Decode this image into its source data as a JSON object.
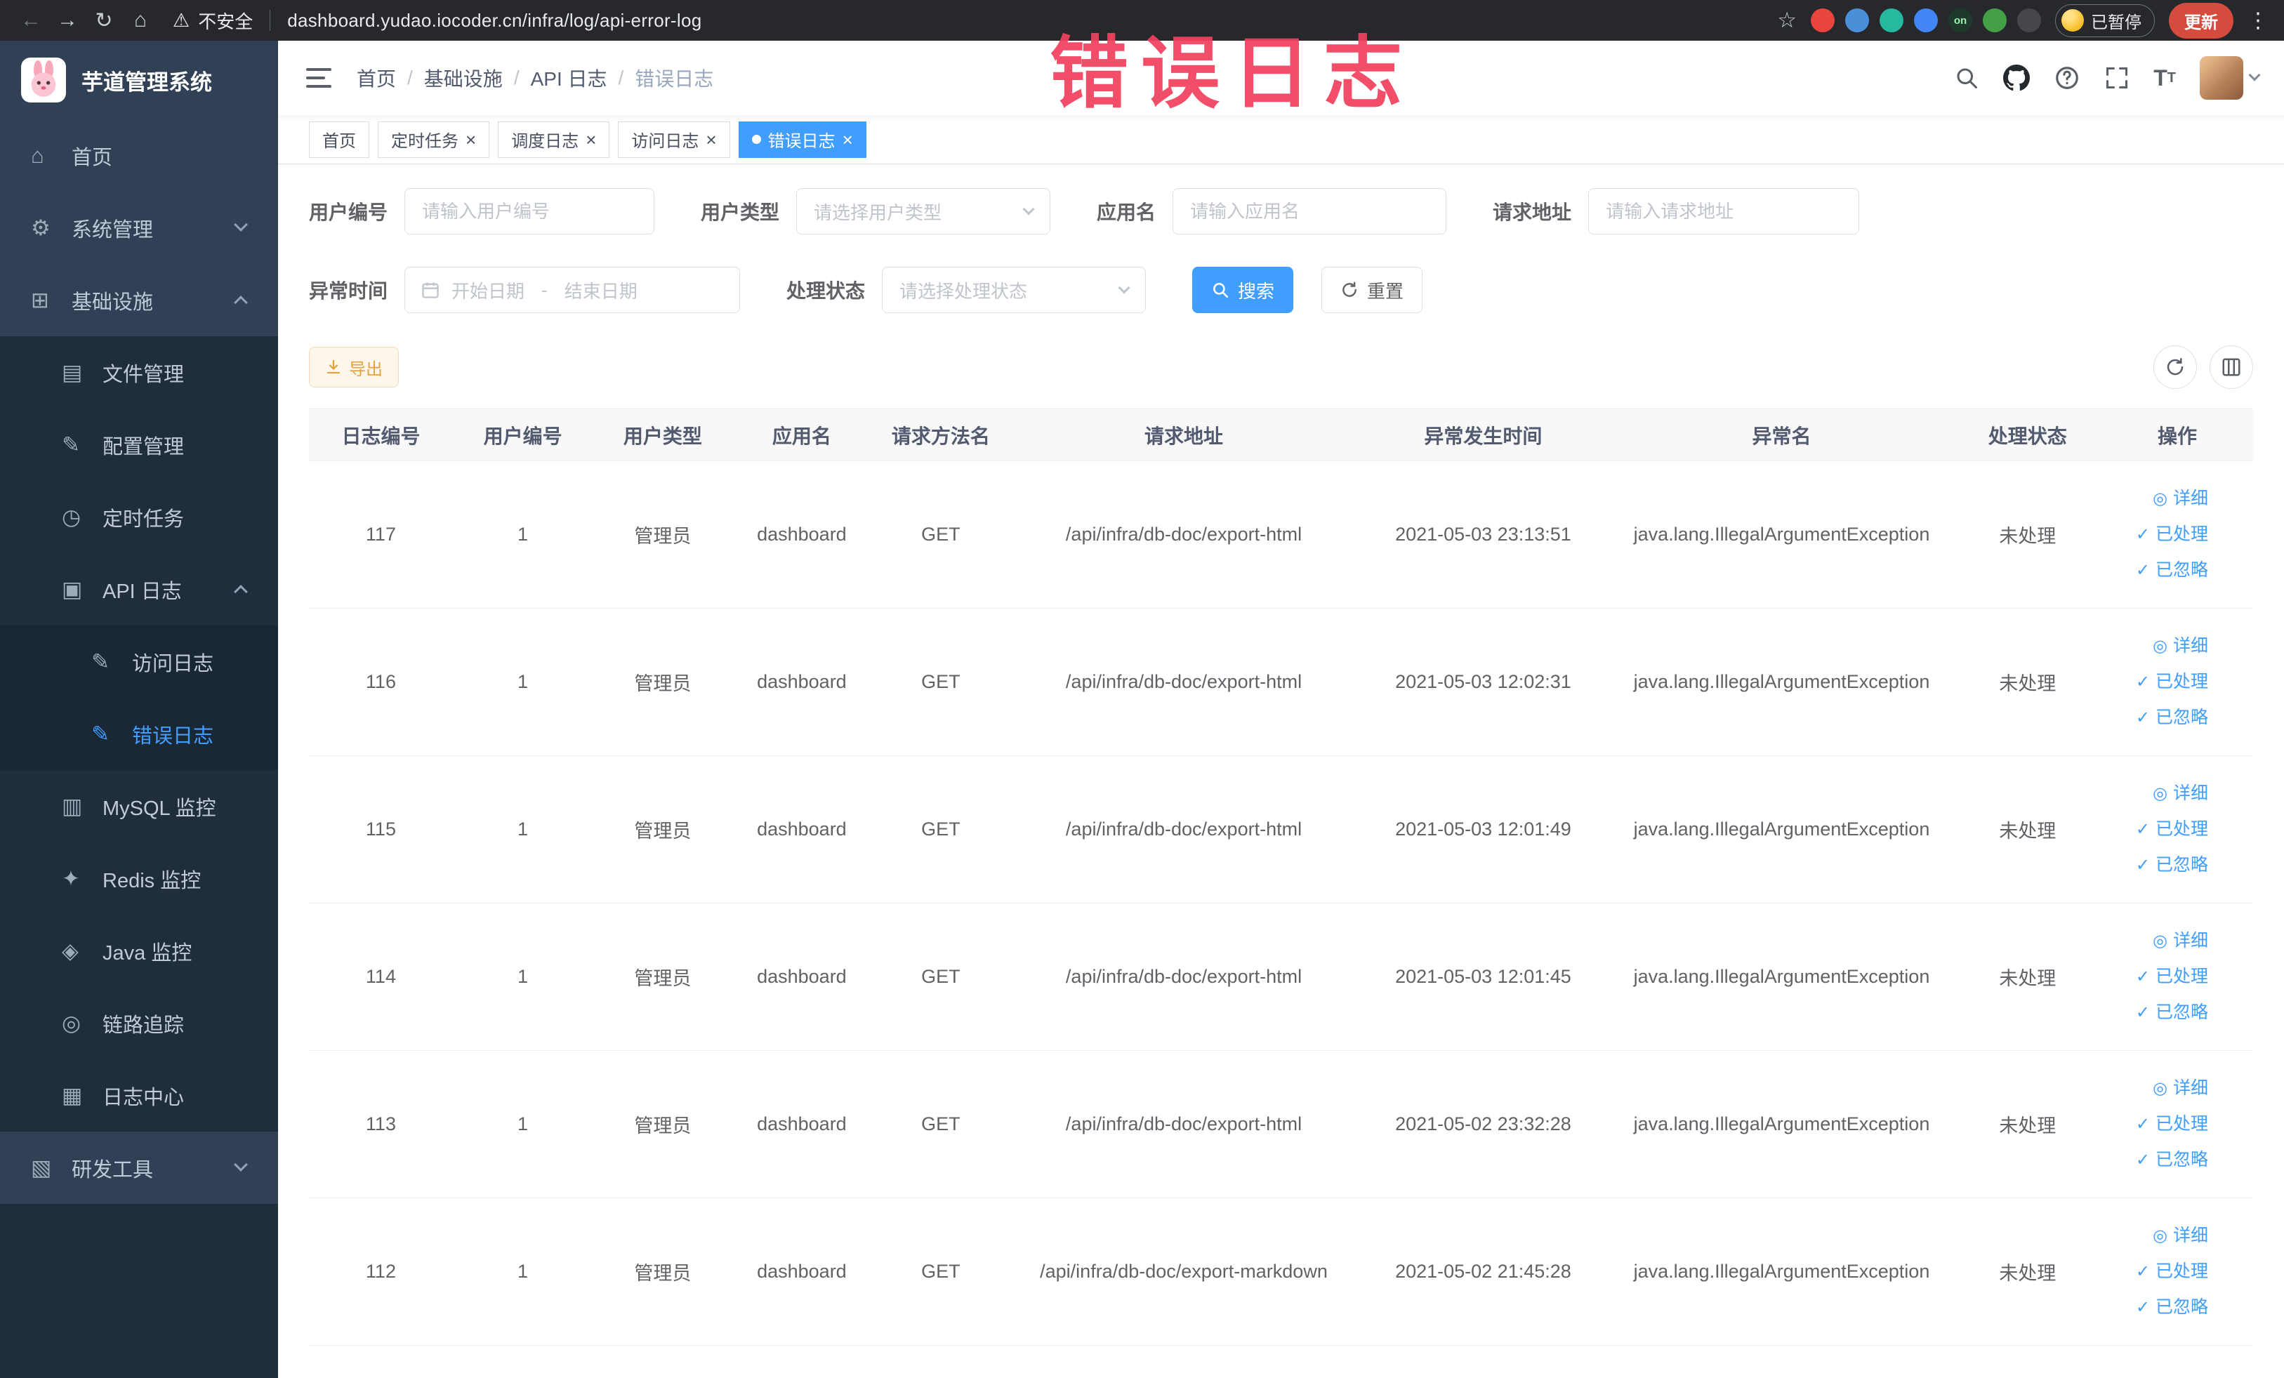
{
  "colors": {
    "accent": "#409eff",
    "sidebar_bg": "#304156",
    "sidebar_submenu_bg": "#1f2d3d",
    "active_menu_text": "#409eff",
    "warning_button_text": "#e6a23c",
    "update_button_bg": "#d54c3f",
    "watermark_color": "#f3415e"
  },
  "watermark": "错误日志",
  "browser": {
    "security_label": "不安全",
    "url": "dashboard.yudao.iocoder.cn/infra/log/api-error-log",
    "paused_label": "已暂停",
    "update_label": "更新",
    "extensions": [
      {
        "name": "extension-red-icon",
        "color": "#e8453c",
        "glyph": ""
      },
      {
        "name": "extension-blue-drop-icon",
        "color": "#4a90d9",
        "glyph": ""
      },
      {
        "name": "extension-teal-icon",
        "color": "#27b8a0",
        "glyph": ""
      },
      {
        "name": "extension-grid-icon",
        "color": "#4285f4",
        "glyph": ""
      },
      {
        "name": "extension-on-badge-icon",
        "color": "#1e3a2a",
        "glyph": "on"
      },
      {
        "name": "extension-leaf-icon",
        "color": "#43a047",
        "glyph": ""
      },
      {
        "name": "extension-paw-icon",
        "color": "#45474a",
        "glyph": ""
      }
    ]
  },
  "sidebar": {
    "logo_title": "芋道管理系统",
    "items": [
      {
        "name": "home",
        "label": "首页",
        "level": 1,
        "icon": "home-icon"
      },
      {
        "name": "system-management",
        "label": "系统管理",
        "level": 1,
        "icon": "gear-icon",
        "chevron": "down"
      },
      {
        "name": "infrastructure",
        "label": "基础设施",
        "level": 1,
        "icon": "infra-icon",
        "chevron": "up"
      },
      {
        "name": "file-management",
        "label": "文件管理",
        "level": 2,
        "icon": "file-icon"
      },
      {
        "name": "config-management",
        "label": "配置管理",
        "level": 2,
        "icon": "config-icon"
      },
      {
        "name": "scheduled-tasks",
        "label": "定时任务",
        "level": 2,
        "icon": "timer-icon"
      },
      {
        "name": "api-logs",
        "label": "API 日志",
        "level": 2,
        "icon": "api-log-icon",
        "chevron": "up"
      },
      {
        "name": "access-logs",
        "label": "访问日志",
        "level": 3,
        "icon": "edit-square-icon"
      },
      {
        "name": "error-logs",
        "label": "错误日志",
        "level": 3,
        "icon": "edit-square-icon",
        "active": true
      },
      {
        "name": "mysql-monitor",
        "label": "MySQL 监控",
        "level": 2,
        "icon": "mysql-icon"
      },
      {
        "name": "redis-monitor",
        "label": "Redis 监控",
        "level": 2,
        "icon": "redis-icon"
      },
      {
        "name": "java-monitor",
        "label": "Java 监控",
        "level": 2,
        "icon": "java-icon"
      },
      {
        "name": "trace",
        "label": "链路追踪",
        "level": 2,
        "icon": "trace-icon"
      },
      {
        "name": "log-center",
        "label": "日志中心",
        "level": 2,
        "icon": "log-center-icon"
      },
      {
        "name": "dev-tools",
        "label": "研发工具",
        "level": 1,
        "icon": "tools-icon",
        "chevron": "down"
      }
    ]
  },
  "header": {
    "breadcrumb": [
      "首页",
      "基础设施",
      "API 日志",
      "错误日志"
    ]
  },
  "tabs": [
    {
      "label": "首页",
      "closable": false,
      "active": false
    },
    {
      "label": "定时任务",
      "closable": true,
      "active": false
    },
    {
      "label": "调度日志",
      "closable": true,
      "active": false
    },
    {
      "label": "访问日志",
      "closable": true,
      "active": false
    },
    {
      "label": "错误日志",
      "closable": true,
      "active": true
    }
  ],
  "filters": {
    "user_id": {
      "label": "用户编号",
      "placeholder": "请输入用户编号"
    },
    "user_type": {
      "label": "用户类型",
      "placeholder": "请选择用户类型"
    },
    "app_name": {
      "label": "应用名",
      "placeholder": "请输入应用名"
    },
    "request_url": {
      "label": "请求地址",
      "placeholder": "请输入请求地址"
    },
    "exception_time": {
      "label": "异常时间",
      "start_placeholder": "开始日期",
      "separator": "-",
      "end_placeholder": "结束日期"
    },
    "process_status": {
      "label": "处理状态",
      "placeholder": "请选择处理状态"
    },
    "search_label": "搜索",
    "reset_label": "重置"
  },
  "toolbar": {
    "export_label": "导出"
  },
  "table": {
    "columns": [
      "日志编号",
      "用户编号",
      "用户类型",
      "应用名",
      "请求方法名",
      "请求地址",
      "异常发生时间",
      "异常名",
      "处理状态",
      "操作"
    ],
    "rows": [
      [
        "117",
        "1",
        "管理员",
        "dashboard",
        "GET",
        "/api/infra/db-doc/export-html",
        "2021-05-03 23:13:51",
        "java.lang.IllegalArgumentException",
        "未处理"
      ],
      [
        "116",
        "1",
        "管理员",
        "dashboard",
        "GET",
        "/api/infra/db-doc/export-html",
        "2021-05-03 12:02:31",
        "java.lang.IllegalArgumentException",
        "未处理"
      ],
      [
        "115",
        "1",
        "管理员",
        "dashboard",
        "GET",
        "/api/infra/db-doc/export-html",
        "2021-05-03 12:01:49",
        "java.lang.IllegalArgumentException",
        "未处理"
      ],
      [
        "114",
        "1",
        "管理员",
        "dashboard",
        "GET",
        "/api/infra/db-doc/export-html",
        "2021-05-03 12:01:45",
        "java.lang.IllegalArgumentException",
        "未处理"
      ],
      [
        "113",
        "1",
        "管理员",
        "dashboard",
        "GET",
        "/api/infra/db-doc/export-html",
        "2021-05-02 23:32:28",
        "java.lang.IllegalArgumentException",
        "未处理"
      ],
      [
        "112",
        "1",
        "管理员",
        "dashboard",
        "GET",
        "/api/infra/db-doc/export-markdown",
        "2021-05-02 21:45:28",
        "java.lang.IllegalArgumentException",
        "未处理"
      ]
    ],
    "row_actions": [
      {
        "name": "detail",
        "icon": "eye-icon",
        "label": "详细"
      },
      {
        "name": "processed",
        "icon": "check-icon",
        "label": "已处理"
      },
      {
        "name": "ignored",
        "icon": "check-icon",
        "label": "已忽略"
      }
    ]
  }
}
